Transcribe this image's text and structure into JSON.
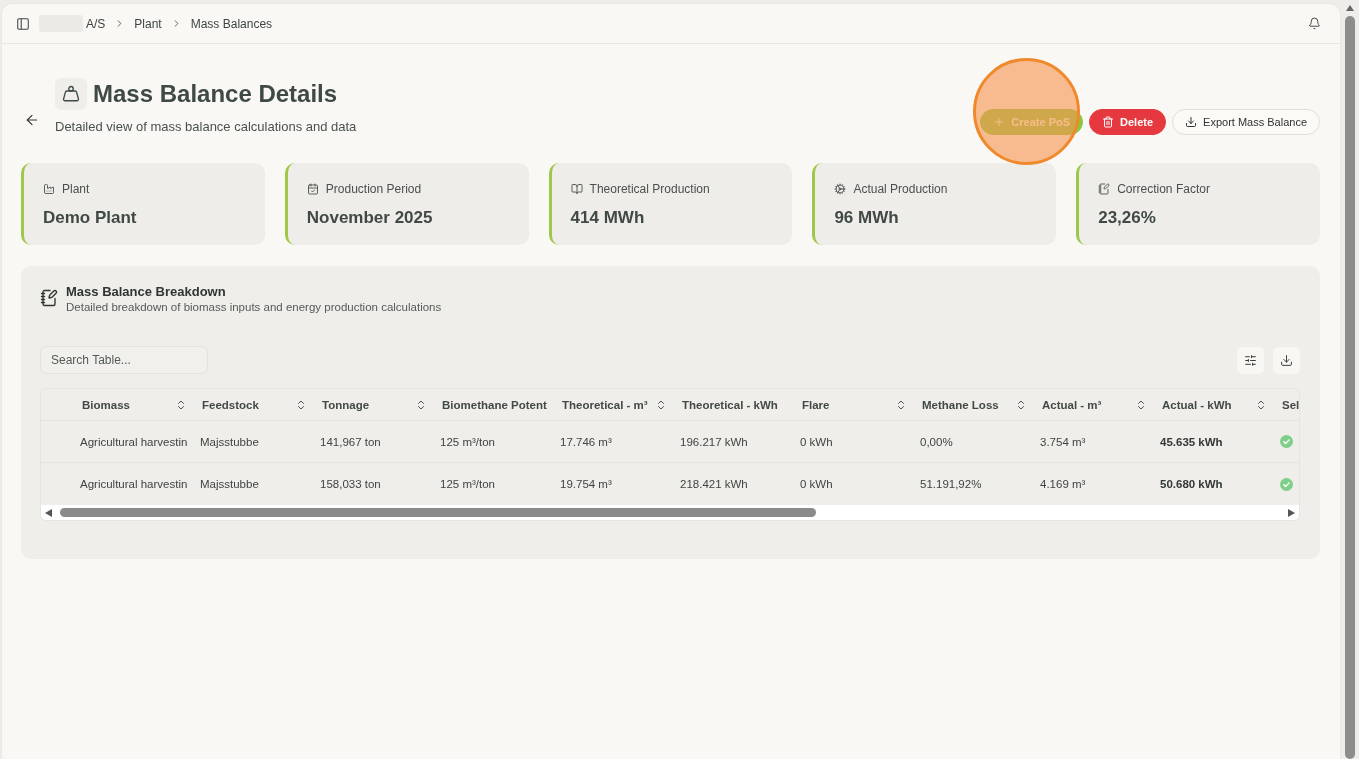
{
  "top_bar": {
    "redacted_prefix": true,
    "breadcrumb": [
      "A/S",
      "Plant",
      "Mass Balances"
    ]
  },
  "header": {
    "title": "Mass Balance Details",
    "subtitle": "Detailed view of mass balance calculations and data",
    "actions": [
      {
        "kind": "create",
        "label": "Create PoS",
        "highlighted": true
      },
      {
        "kind": "delete",
        "label": "Delete",
        "highlighted": false
      },
      {
        "kind": "export",
        "label": "Export Mass Balance",
        "highlighted": false
      }
    ]
  },
  "summary_cards": [
    {
      "kind": "plant",
      "label": "Plant",
      "value": "Demo Plant"
    },
    {
      "kind": "period",
      "label": "Production Period",
      "value": "November 2025"
    },
    {
      "kind": "theoretical",
      "label": "Theoretical Production",
      "value": "414 MWh"
    },
    {
      "kind": "actual",
      "label": "Actual Production",
      "value": "96 MWh"
    },
    {
      "kind": "correction",
      "label": "Correction Factor",
      "value": "23,26%"
    }
  ],
  "breakdown": {
    "title": "Mass Balance Breakdown",
    "subtitle": "Detailed breakdown of biomass inputs and energy production calculations",
    "search": {
      "placeholder": "Search Table..."
    },
    "table": {
      "columns": [
        {
          "kind": "text",
          "label": "Biomass",
          "sortable": true
        },
        {
          "kind": "text",
          "label": "Feedstock",
          "sortable": true
        },
        {
          "kind": "text",
          "label": "Tonnage",
          "sortable": true
        },
        {
          "kind": "text",
          "label": "Biomethane Potent",
          "sortable": false
        },
        {
          "kind": "text",
          "label": "Theoretical - m³",
          "sortable": true
        },
        {
          "kind": "text",
          "label": "Theoretical - kWh",
          "sortable": false
        },
        {
          "kind": "text",
          "label": "Flare",
          "sortable": true
        },
        {
          "kind": "text",
          "label": "Methane Loss",
          "sortable": true
        },
        {
          "kind": "text",
          "label": "Actual - m³",
          "sortable": true
        },
        {
          "kind": "strong",
          "label": "Actual - kWh",
          "sortable": true
        },
        {
          "kind": "check",
          "label": "Sel"
        }
      ],
      "rows": [
        {
          "cells": [
            "Agricultural harvestin",
            "Majsstubbe",
            "141,967 ton",
            "125 m³/ton",
            "17.746 m³",
            "196.217 kWh",
            "0 kWh",
            "0,00%",
            "3.754 m³",
            "45.635 kWh"
          ],
          "checked": true
        },
        {
          "cells": [
            "Agricultural harvestin",
            "Majsstubbe",
            "158,033 ton",
            "125 m³/ton",
            "19.754 m³",
            "218.421 kWh",
            "0 kWh",
            "51.191,92%",
            "4.169 m³",
            "50.680 kWh"
          ],
          "checked": true
        }
      ]
    }
  }
}
